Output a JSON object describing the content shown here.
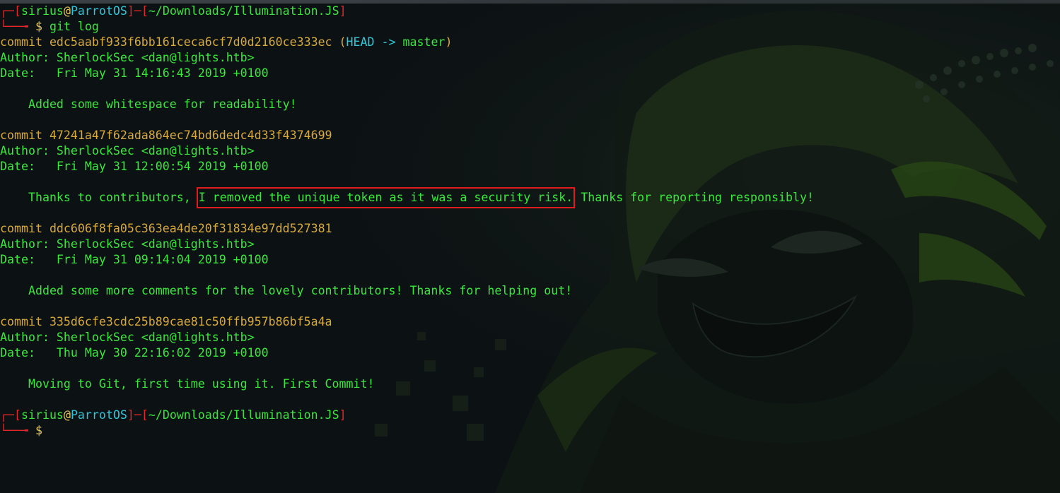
{
  "colors": {
    "background": "#0c1113",
    "prompt_bracket": "#e3262a",
    "user_green": "#39e83c",
    "host_cyan": "#2fc6d9",
    "commit_yellow": "#d9a93a",
    "highlight_box": "#e01d1d"
  },
  "prompts": [
    {
      "corner_top": "┌─",
      "lbracket": "[",
      "user": "sirius",
      "at": "@",
      "host": "ParrotOS",
      "sep": "]─[",
      "path": "~/Downloads/Illumination.JS",
      "rbracket": "]",
      "corner_bottom": "└──╼",
      "dollar": "$",
      "command": " git log"
    },
    {
      "corner_top": "┌─",
      "lbracket": "[",
      "user": "sirius",
      "at": "@",
      "host": "ParrotOS",
      "sep": "]─[",
      "path": "~/Downloads/Illumination.JS",
      "rbracket": "]",
      "corner_bottom": "└──╼",
      "dollar": "$",
      "command": ""
    }
  ],
  "commits": [
    {
      "label": "commit ",
      "hash": "edc5aabf933f6bb161ceca6cf7d0d2160ce333ec",
      "ref_open": " (",
      "ref_head": "HEAD -> ",
      "ref_branch": "master",
      "ref_close": ")",
      "author": "Author: SherlockSec <dan@lights.htb>",
      "date": "Date:   Fri May 31 14:16:43 2019 +0100",
      "message": "Added some whitespace for readability!"
    },
    {
      "label": "commit ",
      "hash": "47241a47f62ada864ec74bd6dedc4d33f4374699",
      "author": "Author: SherlockSec <dan@lights.htb>",
      "date": "Date:   Fri May 31 12:00:54 2019 +0100",
      "message_pre": "Thanks to contributors, ",
      "message_highlight": "I removed the unique token as it was a security risk.",
      "message_post": " Thanks for reporting responsibly!"
    },
    {
      "label": "commit ",
      "hash": "ddc606f8fa05c363ea4de20f31834e97dd527381",
      "author": "Author: SherlockSec <dan@lights.htb>",
      "date": "Date:   Fri May 31 09:14:04 2019 +0100",
      "message": "Added some more comments for the lovely contributors! Thanks for helping out!"
    },
    {
      "label": "commit ",
      "hash": "335d6cfe3cdc25b89cae81c50ffb957b86bf5a4a",
      "author": "Author: SherlockSec <dan@lights.htb>",
      "date": "Date:   Thu May 30 22:16:02 2019 +0100",
      "message": "Moving to Git, first time using it. First Commit!"
    }
  ]
}
